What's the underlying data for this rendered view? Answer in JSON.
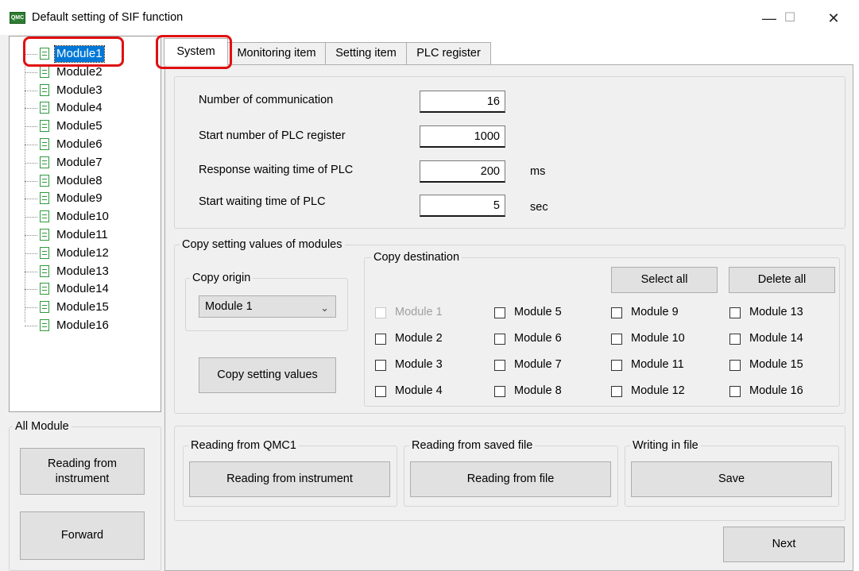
{
  "window": {
    "icon_text": "QMC",
    "title": "Default setting of SIF function",
    "minimize": "—",
    "maximize": "☐",
    "close": "✕"
  },
  "tree": {
    "items": [
      "Module1",
      "Module2",
      "Module3",
      "Module4",
      "Module5",
      "Module6",
      "Module7",
      "Module8",
      "Module9",
      "Module10",
      "Module11",
      "Module12",
      "Module13",
      "Module14",
      "Module15",
      "Module16"
    ],
    "selected_index": 0
  },
  "tabs": [
    {
      "label": "System",
      "active": true
    },
    {
      "label": "Monitoring item",
      "active": false
    },
    {
      "label": "Setting item",
      "active": false
    },
    {
      "label": "PLC register",
      "active": false
    }
  ],
  "system": {
    "comm_label": "Number of communication",
    "comm_value": "16",
    "start_num_label": "Start number of PLC register",
    "start_num_value": "1000",
    "resp_wait_label": "Response waiting time of PLC",
    "resp_wait_value": "200",
    "resp_wait_unit": "ms",
    "start_wait_label": "Start waiting time of PLC",
    "start_wait_value": "5",
    "start_wait_unit": "sec"
  },
  "copy": {
    "group_title": "Copy setting values of modules",
    "origin_title": "Copy origin",
    "origin_selected": "Module 1",
    "copy_button": "Copy setting values",
    "dest_title": "Copy destination",
    "select_all": "Select all",
    "delete_all": "Delete all",
    "destinations": [
      {
        "label": "Module 1",
        "checked": false,
        "disabled": true
      },
      {
        "label": "Module 2",
        "checked": false,
        "disabled": false
      },
      {
        "label": "Module 3",
        "checked": false,
        "disabled": false
      },
      {
        "label": "Module 4",
        "checked": false,
        "disabled": false
      },
      {
        "label": "Module 5",
        "checked": false,
        "disabled": false
      },
      {
        "label": "Module 6",
        "checked": false,
        "disabled": false
      },
      {
        "label": "Module 7",
        "checked": false,
        "disabled": false
      },
      {
        "label": "Module 8",
        "checked": false,
        "disabled": false
      },
      {
        "label": "Module 9",
        "checked": false,
        "disabled": false
      },
      {
        "label": "Module 10",
        "checked": false,
        "disabled": false
      },
      {
        "label": "Module 11",
        "checked": false,
        "disabled": false
      },
      {
        "label": "Module 12",
        "checked": false,
        "disabled": false
      },
      {
        "label": "Module 13",
        "checked": false,
        "disabled": false
      },
      {
        "label": "Module 14",
        "checked": false,
        "disabled": false
      },
      {
        "label": "Module 15",
        "checked": false,
        "disabled": false
      },
      {
        "label": "Module 16",
        "checked": false,
        "disabled": false
      }
    ]
  },
  "io": {
    "reading_qmc_title": "Reading from QMC1",
    "reading_instrument_button": "Reading from instrument",
    "reading_file_title": "Reading from saved file",
    "reading_file_button": "Reading from file",
    "writing_title": "Writing in file",
    "save_button": "Save",
    "next_button": "Next"
  },
  "all_module": {
    "title": "All Module",
    "read_button": "Reading from instrument",
    "forward_button": "Forward"
  },
  "colors": {
    "highlight_red": "#e01010",
    "selection_blue": "#0078d7",
    "doc_icon_green": "#2e9a3e"
  }
}
